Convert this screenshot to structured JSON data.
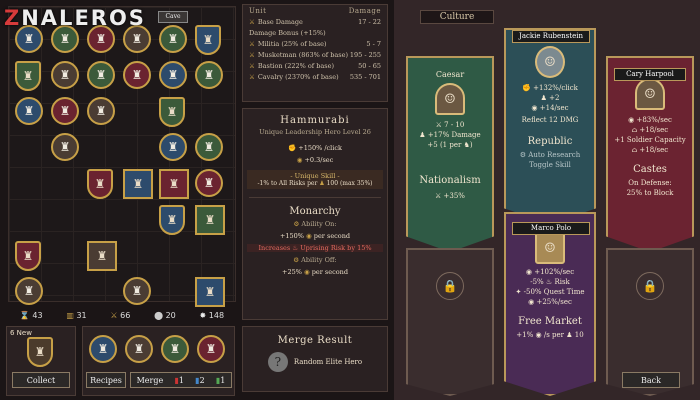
{
  "site": {
    "logo_prefix": "Z",
    "logo_rest": "NALEROS"
  },
  "board": {
    "top_label": "Cave"
  },
  "stats": [
    {
      "icon": "⌛",
      "value": "43"
    },
    {
      "icon": "▥",
      "value": "31"
    },
    {
      "icon": "⚔",
      "value": "66"
    },
    {
      "icon": "⬤",
      "value": "20"
    },
    {
      "icon": "✸",
      "value": "148"
    }
  ],
  "bottom": {
    "new_count": "6 New",
    "collect": "Collect",
    "recipes": "Recipes",
    "merge": "Merge",
    "merge_a": "1",
    "merge_b": "2",
    "merge_c": "1"
  },
  "damage": {
    "col1": "Unit",
    "col2": "Damage",
    "base_label": "Base Damage",
    "base_value": "17 - 22",
    "bonus_label": "Damage Bonus (+15%)",
    "rows": [
      {
        "label": "Militia (25% of base)",
        "value": "5 - 7"
      },
      {
        "label": "Musketman (863% of base)",
        "value": "195 - 255"
      },
      {
        "label": "Bastion (222% of base)",
        "value": "50 - 65"
      },
      {
        "label": "Cavalry (2370% of base)",
        "value": "535 - 701"
      }
    ]
  },
  "hero": {
    "name": "Hammurabi",
    "sub": "Unique Leadership Hero Level 26",
    "l1": "+150% /click",
    "l2": "+0.3/sec",
    "skill_label": "- Unique Skill -",
    "skill_text": "-1% to All Risks per",
    "skill_val": "100 (max 35%)"
  },
  "gov": {
    "name": "Monarchy",
    "on": "Ability On:",
    "on1": "+150%",
    "on1b": "per second",
    "inc": "Increases",
    "inc2": "Uprising Risk by 15%",
    "off": "Ability Off:",
    "off1": "+25%",
    "off1b": "per second"
  },
  "merge_result": {
    "title": "Merge Result",
    "text": "Random Elite Hero"
  },
  "culture": {
    "title": "Culture",
    "back": "Back",
    "caesar": {
      "name": "Caesar",
      "l1": "7 - 10",
      "l2": "+17% Damage",
      "l3": "+5 (1 per",
      "ideo": "Nationalism",
      "ideo_val": "+35%"
    },
    "jackie": {
      "name": "Jackie Rubenstein",
      "l1": "+132%/click",
      "l2": "+2",
      "l3": "+14/sec",
      "l4": "Reflect 12 DMG",
      "ideo": "Republic",
      "ideo_l1": "Auto Research",
      "ideo_l2": "Toggle Skill"
    },
    "cary": {
      "name": "Cary Harpool",
      "l1": "+83%/sec",
      "l2": "+18/sec",
      "l3": "+1 Soldier Capacity",
      "l4": "+18/sec",
      "ideo": "Castes",
      "ideo_l1": "On Defense:",
      "ideo_l2": "25% to Block"
    },
    "marco": {
      "name": "Marco Polo",
      "l1": "+102%/sec",
      "l2": "-5%",
      "l2b": "Risk",
      "l3": "-50% Quest Time",
      "l4": "+25%/sec",
      "ideo": "Free Market",
      "ideo_l1": "+1%",
      "ideo_l1b": "/s per",
      "ideo_l1c": "10"
    }
  },
  "colors": {
    "green": "#2f5a45",
    "teal": "#2c4f57",
    "red": "#6b2331",
    "purple": "#4a2b55",
    "gold": "#c7a047"
  }
}
